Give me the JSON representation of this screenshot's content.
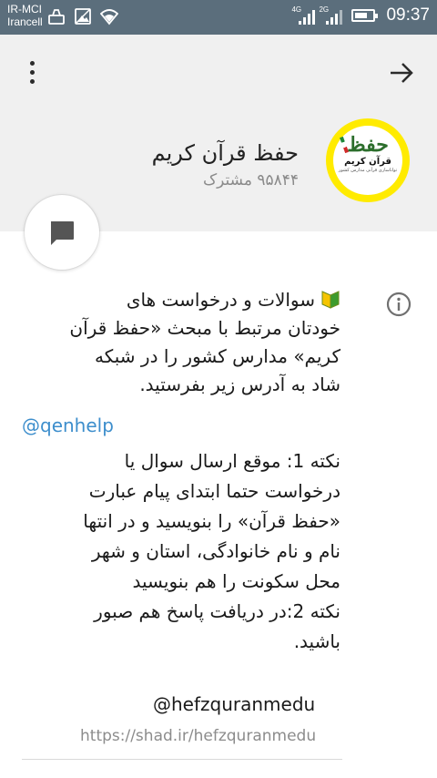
{
  "statusbar": {
    "carrier_line1": "IR-MCI",
    "carrier_line2": "Irancell",
    "network1": "4G",
    "network2": "2G",
    "battery_level": 0.7,
    "time": "09:37"
  },
  "header": {
    "channel_name": "حفظ قرآن کریم",
    "subscribers": "۹۵۸۴۴ مشترک",
    "avatar": {
      "logo_title": "حفظ",
      "logo_subtitle": "قرآن کریم",
      "logo_caption": "تواناسازی قرآنی مدارس کشور",
      "ring_color": "#ffeb00"
    },
    "menu_icon": "more-vert-icon",
    "back_icon": "arrow-forward-icon"
  },
  "chat_button": {
    "icon": "chat-bubble-icon"
  },
  "info": {
    "icon": "info-icon",
    "description": "سوالات و درخواست های\nخودتان مرتبط با مبحث «حفظ قرآن\nکریم» مدارس کشور را در شبکه\nشاد به آدرس زیر بفرستید.",
    "handle1": "@qenhelp",
    "note": "نکته 1: موقع ارسال سوال یا\nدرخواست حتما ابتدای پیام عبارت\n«حفظ قرآن» را بنویسید و در انتها\nنام و نام خانوادگی، استان و شهر\nمحل سکونت را هم بنویسید\nنکته 2:در دریافت پاسخ هم صبور\nباشید.",
    "handle2": "@hefzquranmedu",
    "link": "https://shad.ir/hefzquranmedu"
  },
  "colors": {
    "statusbar_bg": "#5b6e7c",
    "header_bg": "#f0f0f0",
    "link_color": "#3d8ecc"
  }
}
